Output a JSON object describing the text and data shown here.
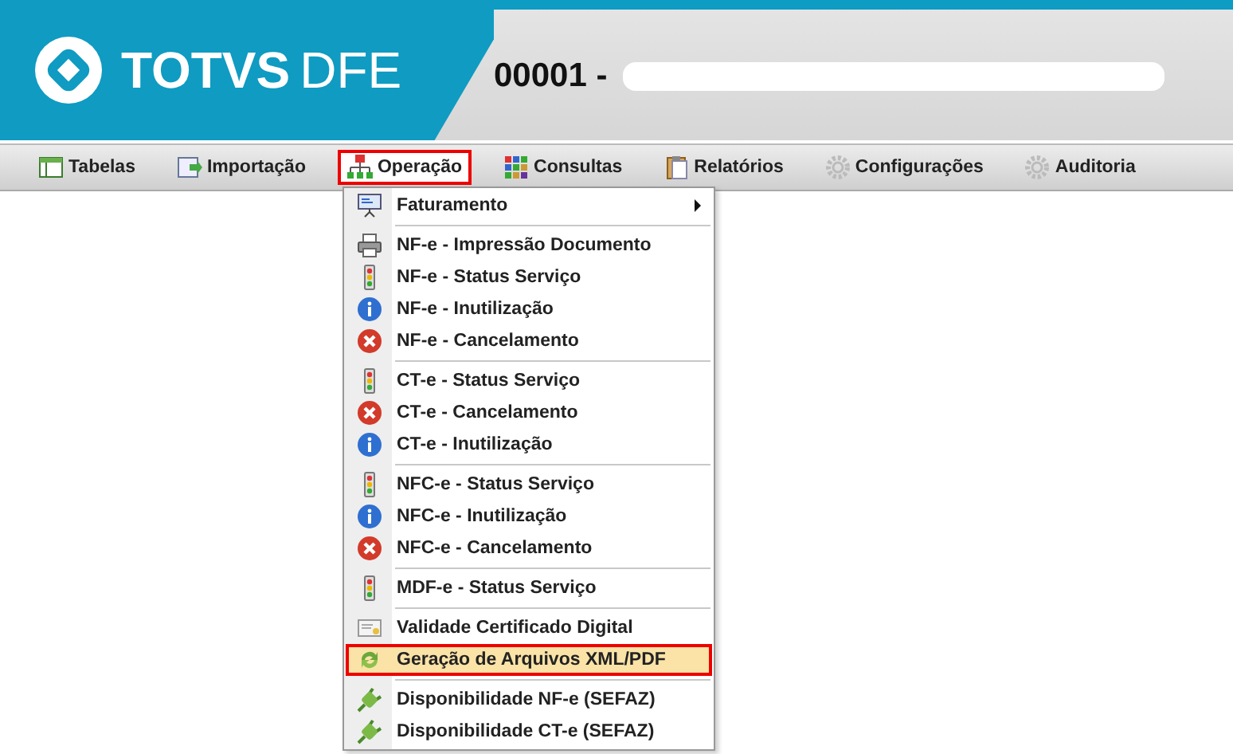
{
  "header": {
    "logo": "TOTVS",
    "logo_suffix": "DFE",
    "company_code": "00001 -"
  },
  "toolbar": [
    {
      "label": "Tabelas",
      "kind": "table",
      "selected": false,
      "outlined": false
    },
    {
      "label": "Importação",
      "kind": "import",
      "selected": false,
      "outlined": false
    },
    {
      "label": "Operação",
      "kind": "hierarchy",
      "selected": true,
      "outlined": true
    },
    {
      "label": "Consultas",
      "kind": "grid",
      "selected": false,
      "outlined": false
    },
    {
      "label": "Relatórios",
      "kind": "clipboard",
      "selected": false,
      "outlined": false
    },
    {
      "label": "Configurações",
      "kind": "gear",
      "selected": false,
      "outlined": false
    },
    {
      "label": "Auditoria",
      "kind": "gear",
      "selected": false,
      "outlined": false
    }
  ],
  "menu": {
    "groups": [
      [
        {
          "label": "Faturamento",
          "kind": "presentation",
          "submenu": true,
          "selected": false,
          "outlined": false
        }
      ],
      [
        {
          "label": "NF-e - Impressão Documento",
          "kind": "printer",
          "submenu": false,
          "selected": false,
          "outlined": false
        },
        {
          "label": "NF-e - Status Serviço",
          "kind": "traffic",
          "submenu": false,
          "selected": false,
          "outlined": false
        },
        {
          "label": "NF-e - Inutilização",
          "kind": "info",
          "submenu": false,
          "selected": false,
          "outlined": false
        },
        {
          "label": "NF-e - Cancelamento",
          "kind": "cancel",
          "submenu": false,
          "selected": false,
          "outlined": false
        }
      ],
      [
        {
          "label": "CT-e - Status Serviço",
          "kind": "traffic",
          "submenu": false,
          "selected": false,
          "outlined": false
        },
        {
          "label": "CT-e - Cancelamento",
          "kind": "cancel",
          "submenu": false,
          "selected": false,
          "outlined": false
        },
        {
          "label": "CT-e - Inutilização",
          "kind": "info",
          "submenu": false,
          "selected": false,
          "outlined": false
        }
      ],
      [
        {
          "label": "NFC-e - Status Serviço",
          "kind": "traffic",
          "submenu": false,
          "selected": false,
          "outlined": false
        },
        {
          "label": "NFC-e - Inutilização",
          "kind": "info",
          "submenu": false,
          "selected": false,
          "outlined": false
        },
        {
          "label": "NFC-e - Cancelamento",
          "kind": "cancel",
          "submenu": false,
          "selected": false,
          "outlined": false
        }
      ],
      [
        {
          "label": "MDF-e - Status Serviço",
          "kind": "traffic",
          "submenu": false,
          "selected": false,
          "outlined": false
        }
      ],
      [
        {
          "label": "Validade Certificado Digital",
          "kind": "certificate",
          "submenu": false,
          "selected": false,
          "outlined": false
        },
        {
          "label": "Geração de Arquivos XML/PDF",
          "kind": "recycle",
          "submenu": false,
          "selected": true,
          "outlined": true
        }
      ],
      [
        {
          "label": "Disponibilidade NF-e (SEFAZ)",
          "kind": "plug",
          "submenu": false,
          "selected": false,
          "outlined": false
        },
        {
          "label": "Disponibilidade CT-e (SEFAZ)",
          "kind": "plug",
          "submenu": false,
          "selected": false,
          "outlined": false
        }
      ]
    ]
  }
}
